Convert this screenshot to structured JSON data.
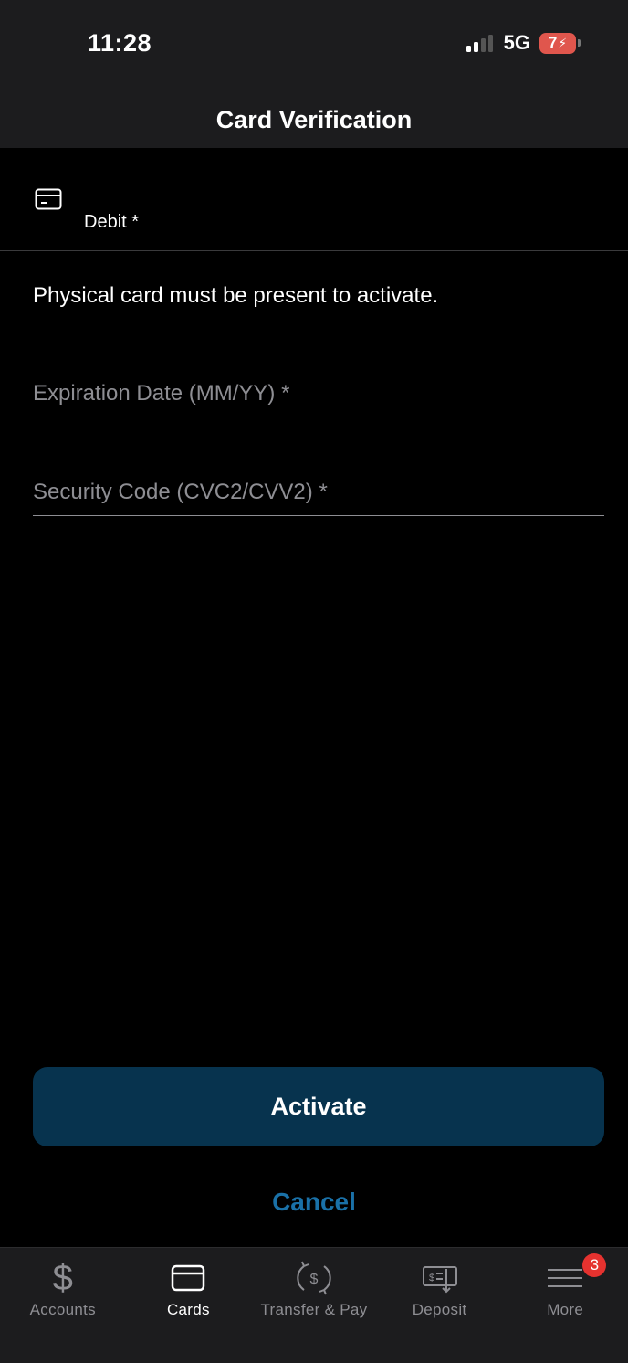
{
  "status_bar": {
    "time": "11:28",
    "network": "5G",
    "battery": "7"
  },
  "header": {
    "title": "Card Verification"
  },
  "card": {
    "label": "Debit *",
    "icon": "credit-card-icon"
  },
  "form": {
    "notice": "Physical card must be present to activate.",
    "expiration_placeholder": "Expiration Date (MM/YY) *",
    "expiration_value": "",
    "security_placeholder": "Security Code (CVC2/CVV2) *",
    "security_value": "",
    "activate_label": "Activate",
    "cancel_label": "Cancel"
  },
  "tabbar": {
    "tabs": [
      {
        "label": "Accounts",
        "icon": "dollar-icon",
        "active": false
      },
      {
        "label": "Cards",
        "icon": "card-icon",
        "active": true
      },
      {
        "label": "Transfer & Pay",
        "icon": "transfer-icon",
        "active": false
      },
      {
        "label": "Deposit",
        "icon": "deposit-check-icon",
        "active": false
      },
      {
        "label": "More",
        "icon": "menu-icon",
        "active": false,
        "badge": "3"
      }
    ]
  },
  "colors": {
    "background": "#000000",
    "header": "#1c1c1e",
    "accent_button": "#07334e",
    "link": "#1a71a8",
    "badge": "#e5322f",
    "battery": "#e0564d"
  }
}
